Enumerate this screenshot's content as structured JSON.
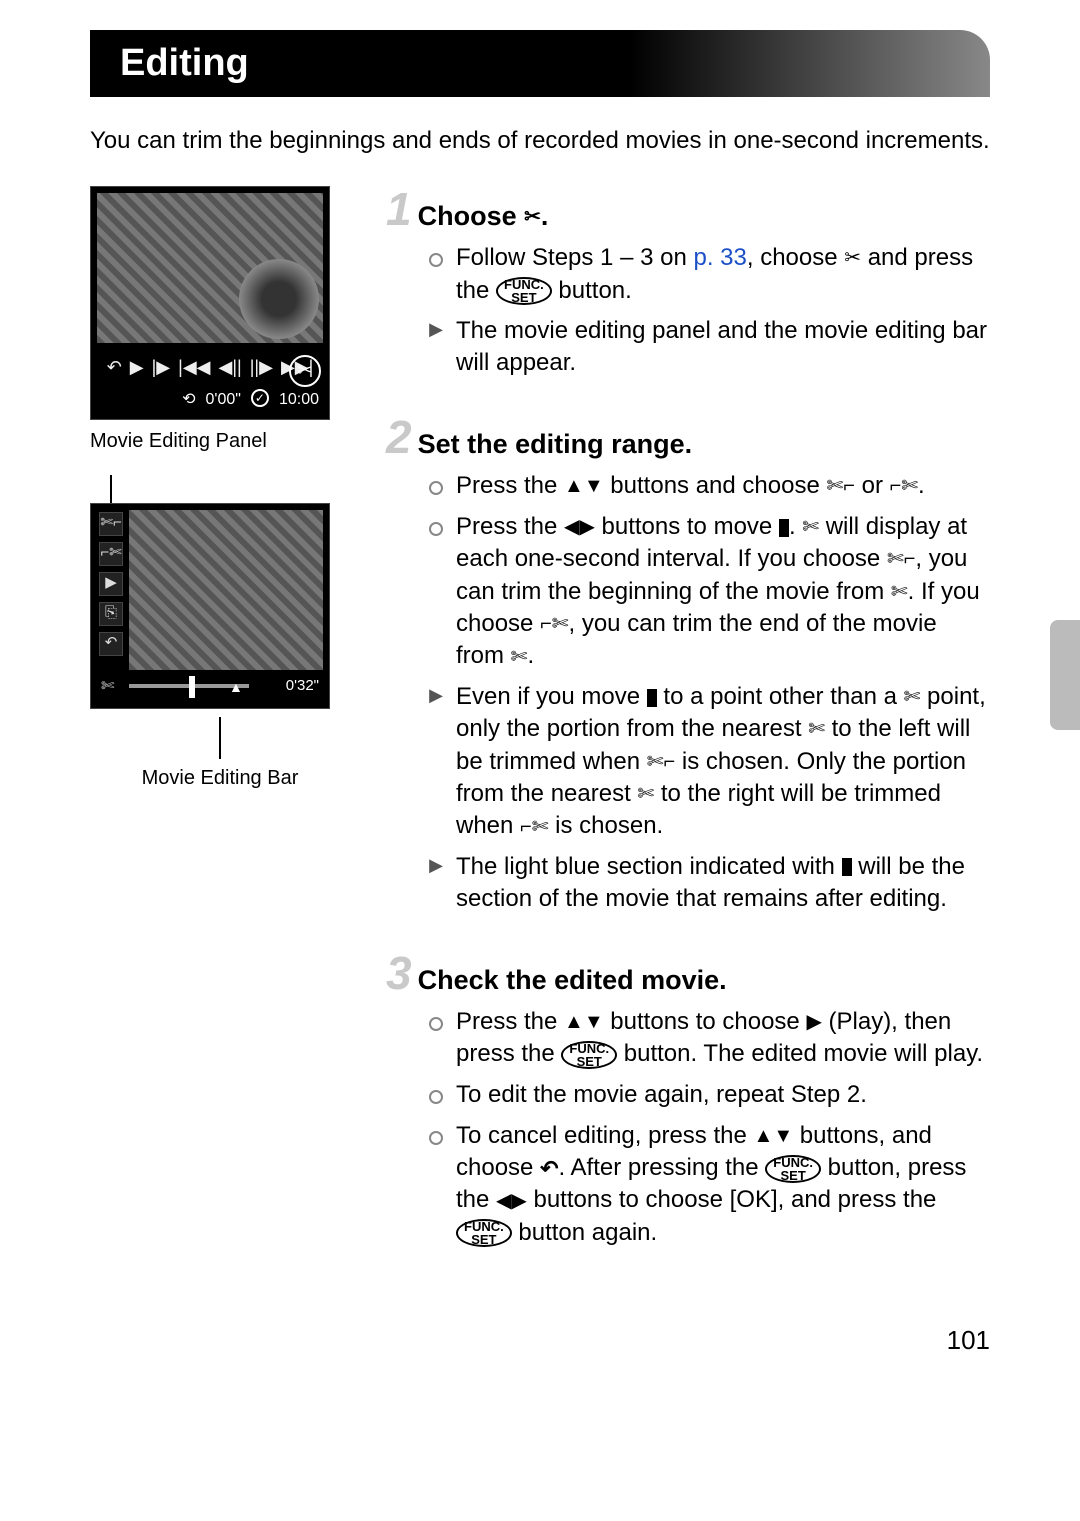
{
  "header": {
    "title": "Editing"
  },
  "intro": "You can trim the beginnings and ends of recorded movies in one-second increments.",
  "figures": {
    "panel_caption": "Movie Editing Panel",
    "bar_caption": "Movie Editing Bar",
    "screen1": {
      "elapsed": "0'00\"",
      "total": "10:00"
    },
    "screen2": {
      "time": "0'32\""
    }
  },
  "steps": [
    {
      "num": "1",
      "title_prefix": "Choose ",
      "title_icon": "scissors-open",
      "title_suffix": ".",
      "items": [
        {
          "kind": "disc",
          "segments": [
            {
              "t": "Follow Steps 1 – 3 on "
            },
            {
              "t": "p. 33",
              "link": true
            },
            {
              "t": ", choose "
            },
            {
              "icon": "scissors-open"
            },
            {
              "t": " and press the "
            },
            {
              "icon": "funcset"
            },
            {
              "t": " button."
            }
          ]
        },
        {
          "kind": "tri",
          "segments": [
            {
              "t": "The movie editing panel and the movie editing bar will appear."
            }
          ]
        }
      ]
    },
    {
      "num": "2",
      "title_prefix": "Set the editing range.",
      "items": [
        {
          "kind": "disc",
          "segments": [
            {
              "t": "Press the "
            },
            {
              "icon": "up"
            },
            {
              "icon": "down"
            },
            {
              "t": " buttons and choose "
            },
            {
              "icon": "cut-begin"
            },
            {
              "t": " or "
            },
            {
              "icon": "cut-end"
            },
            {
              "t": "."
            }
          ]
        },
        {
          "kind": "disc",
          "segments": [
            {
              "t": "Press the "
            },
            {
              "icon": "left"
            },
            {
              "icon": "right"
            },
            {
              "t": " buttons to move "
            },
            {
              "icon": "handle-mark"
            },
            {
              "t": ". "
            },
            {
              "icon": "scissors"
            },
            {
              "t": " will display at each one-second interval. If you choose "
            },
            {
              "icon": "cut-begin"
            },
            {
              "t": ", you can trim the beginning of the movie from "
            },
            {
              "icon": "scissors"
            },
            {
              "t": ". If you choose "
            },
            {
              "icon": "cut-end"
            },
            {
              "t": ", you can trim the end of the movie from "
            },
            {
              "icon": "scissors"
            },
            {
              "t": "."
            }
          ]
        },
        {
          "kind": "tri",
          "segments": [
            {
              "t": "Even if you move "
            },
            {
              "icon": "handle-mark"
            },
            {
              "t": " to a point other than a "
            },
            {
              "icon": "scissors"
            },
            {
              "t": " point, only the portion from the nearest "
            },
            {
              "icon": "scissors"
            },
            {
              "t": " to the left will be trimmed when "
            },
            {
              "icon": "cut-begin"
            },
            {
              "t": " is chosen. Only the portion from the nearest "
            },
            {
              "icon": "scissors"
            },
            {
              "t": " to the right will be trimmed when "
            },
            {
              "icon": "cut-end"
            },
            {
              "t": " is chosen."
            }
          ]
        },
        {
          "kind": "tri",
          "segments": [
            {
              "t": "The light blue section indicated with "
            },
            {
              "icon": "handle-mark"
            },
            {
              "t": " will be the section of the movie that remains after editing."
            }
          ]
        }
      ]
    },
    {
      "num": "3",
      "title_prefix": "Check the edited movie.",
      "items": [
        {
          "kind": "disc",
          "segments": [
            {
              "t": "Press the "
            },
            {
              "icon": "up"
            },
            {
              "icon": "down"
            },
            {
              "t": " buttons to choose "
            },
            {
              "icon": "play"
            },
            {
              "t": " (Play), then press the "
            },
            {
              "icon": "funcset"
            },
            {
              "t": " button. The edited movie will play."
            }
          ]
        },
        {
          "kind": "disc",
          "segments": [
            {
              "t": "To edit the movie again, repeat Step 2."
            }
          ]
        },
        {
          "kind": "disc",
          "segments": [
            {
              "t": "To cancel editing, press the "
            },
            {
              "icon": "up"
            },
            {
              "icon": "down"
            },
            {
              "t": " buttons, and choose "
            },
            {
              "icon": "return"
            },
            {
              "t": ". After pressing the "
            },
            {
              "icon": "funcset"
            },
            {
              "t": " button, press the "
            },
            {
              "icon": "left"
            },
            {
              "icon": "right"
            },
            {
              "t": " buttons to choose [OK], and press the "
            },
            {
              "icon": "funcset"
            },
            {
              "t": " button again."
            }
          ]
        }
      ]
    }
  ],
  "page_number": "101"
}
